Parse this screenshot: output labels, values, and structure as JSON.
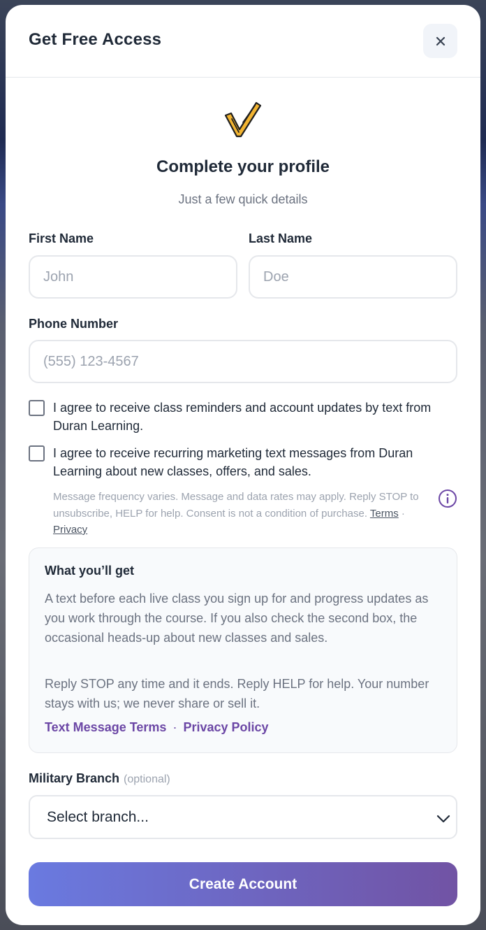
{
  "colors": {
    "accent": "#6b46a5",
    "button_start": "#6a7ae0",
    "button_end": "#7153a4",
    "logo_gold": "#f2b431"
  },
  "header": {
    "title": "Get Free Access",
    "close_icon": "close-icon"
  },
  "hero": {
    "logo_icon": "checkmark-logo-icon",
    "title": "Complete your profile",
    "subtitle": "Just a few quick details"
  },
  "form": {
    "first_name": {
      "label": "First Name",
      "placeholder": "John",
      "value": ""
    },
    "last_name": {
      "label": "Last Name",
      "placeholder": "Doe",
      "value": ""
    },
    "phone": {
      "label": "Phone Number",
      "placeholder": "(555) 123-4567",
      "value": ""
    },
    "consent_reminders": {
      "checked": false,
      "text": "I agree to receive class reminders and account updates by text from Duran Learning."
    },
    "consent_marketing": {
      "checked": false,
      "text": "I agree to receive recurring marketing text messages from Duran Learning about new classes, offers, and sales."
    },
    "disclaimer": {
      "text": "Message frequency varies. Message and data rates may apply. Reply STOP to unsubscribe, HELP for help. Consent is not a condition of purchase.",
      "terms_link": "Terms",
      "separator": "·",
      "privacy_link": "Privacy",
      "info_icon": "info-icon"
    },
    "military_branch": {
      "label": "Military Branch",
      "optional": "(optional)",
      "selected": "Select branch..."
    },
    "submit_label": "Create Account"
  },
  "info_card": {
    "title": "What you’ll get",
    "paragraph1": "A text before each live class you sign up for and progress updates as you work through the course. If you also check the second box, the occasional heads-up about new classes and sales.",
    "paragraph2": "Reply STOP any time and it ends. Reply HELP for help. Your number stays with us; we never share or sell it.",
    "link_terms": "Text Message Terms",
    "separator": "·",
    "link_privacy": "Privacy Policy"
  }
}
